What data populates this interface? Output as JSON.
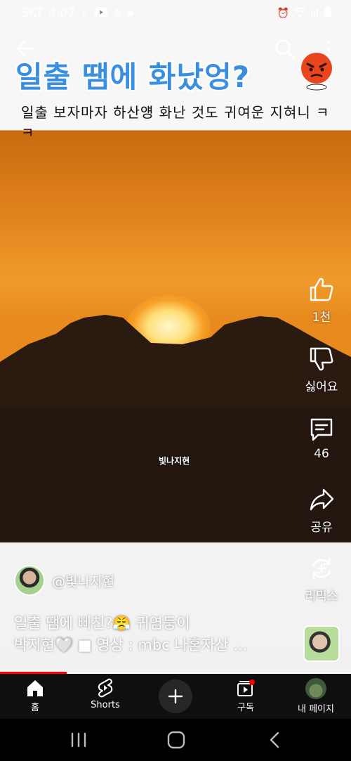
{
  "status_bar": {
    "carrier": "SKT",
    "time": "4:07",
    "icons": [
      "hand-icon",
      "youtube-icon",
      "settings-icon",
      "dot-icon",
      "alarm-icon",
      "wifi-icon",
      "signal-icon",
      "battery-icon"
    ]
  },
  "overlay_caption": {
    "title": "일출 땜에 화났엉?",
    "subtitle": "일출 보자마자 하산얭 화난 것도 귀여운 지혀니 ㅋㅋ"
  },
  "watermark": "빛나지현",
  "actions": {
    "like_label": "1천",
    "dislike_label": "싫어요",
    "comments_label": "46",
    "share_label": "공유",
    "remix_label": "리믹스"
  },
  "channel": {
    "handle": "@빛나지현"
  },
  "description": {
    "line1": "일출 땜에 삐친?😤 귀염둥이",
    "line2": "박지현🤍 ■ 영상 : mbc 나혼자산 ..."
  },
  "progress": {
    "fraction": 0.19,
    "color": "#ff0000"
  },
  "bottom_nav": {
    "home_label": "홈",
    "shorts_label": "Shorts",
    "subscriptions_label": "구독",
    "profile_label": "내 페이지"
  },
  "colors": {
    "title_blue": "#3a8ee0",
    "nav_background": "#0f0f0f",
    "notification_dot": "#ff0000"
  }
}
